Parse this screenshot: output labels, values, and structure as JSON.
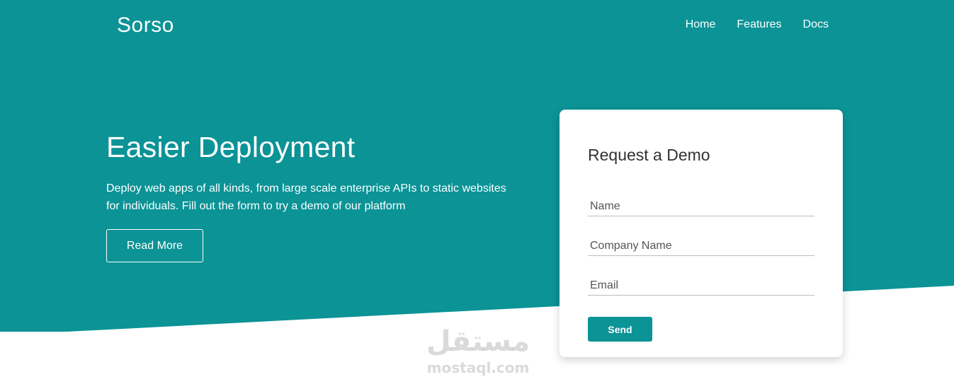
{
  "brand": {
    "name": "Sorso",
    "color": "#0b9396"
  },
  "nav": {
    "items": [
      {
        "label": "Home"
      },
      {
        "label": "Features"
      },
      {
        "label": "Docs"
      }
    ]
  },
  "hero": {
    "title": "Easier Deployment",
    "description": "Deploy web apps of all kinds, from large scale enterprise APIs to static websites for individuals. Fill out the form to try a demo of our platform",
    "read_more_label": "Read More"
  },
  "demo_form": {
    "title": "Request a Demo",
    "name_placeholder": "Name",
    "company_placeholder": "Company Name",
    "email_placeholder": "Email",
    "send_label": "Send"
  },
  "watermark": {
    "arabic": "مستقل",
    "latin": "mostaql.com"
  }
}
